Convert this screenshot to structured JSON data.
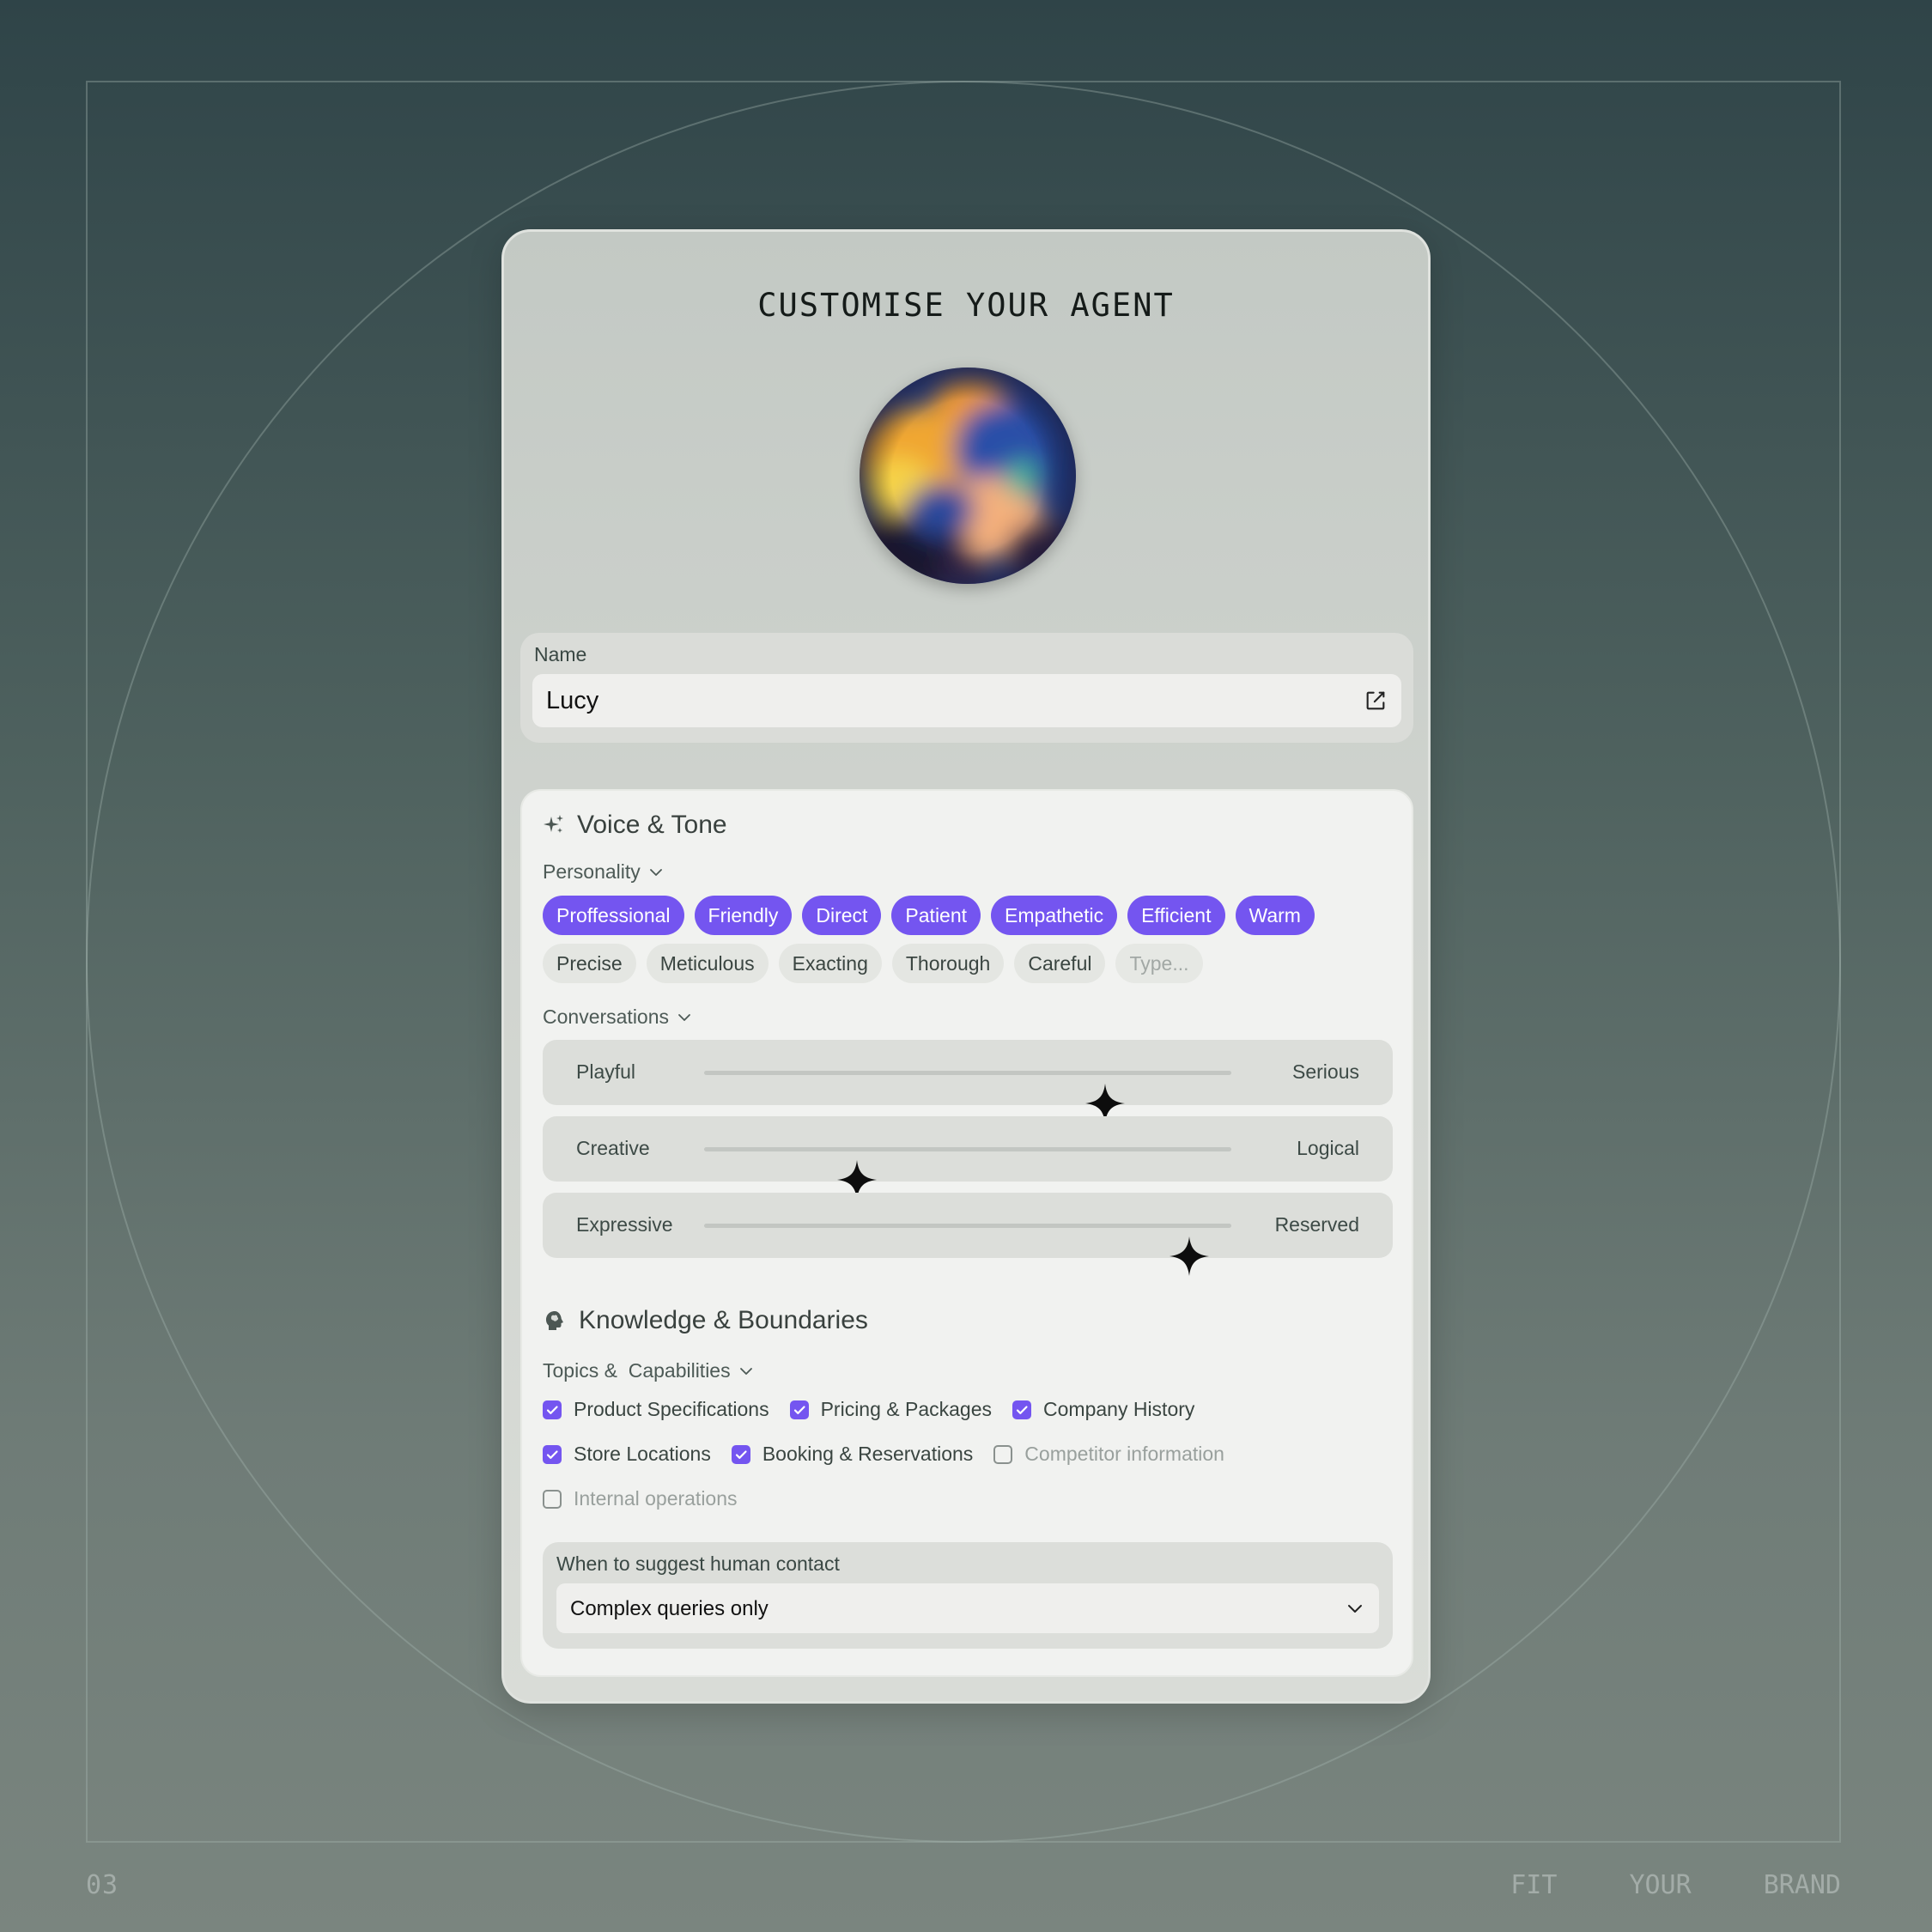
{
  "title": "CUSTOMISE YOUR AGENT",
  "footer": {
    "page_number": "03",
    "words": [
      "FIT",
      "YOUR",
      "BRAND"
    ]
  },
  "name_field": {
    "label": "Name",
    "value": "Lucy",
    "icon": "edit-icon"
  },
  "voice_tone": {
    "heading": "Voice & Tone",
    "icon": "sparkles-icon",
    "personality": {
      "label": "Personality",
      "selected": [
        "Proffessional",
        "Friendly",
        "Direct",
        "Patient",
        "Empathetic",
        "Efficient",
        "Warm"
      ],
      "unselected": [
        "Precise",
        "Meticulous",
        "Exacting",
        "Thorough",
        "Careful"
      ],
      "input_placeholder": "Type..."
    },
    "conversations": {
      "label": "Conversations",
      "sliders": [
        {
          "left": "Playful",
          "right": "Serious",
          "value": 0.76
        },
        {
          "left": "Creative",
          "right": "Logical",
          "value": 0.29
        },
        {
          "left": "Expressive",
          "right": "Reserved",
          "value": 0.92
        }
      ]
    }
  },
  "knowledge": {
    "heading": "Knowledge & Boundaries",
    "icon": "brain-head-icon",
    "topics_label": "Topics &  Capabilities",
    "topics": [
      [
        {
          "label": "Product Specifications",
          "checked": true
        },
        {
          "label": "Pricing & Packages",
          "checked": true
        },
        {
          "label": "Company History",
          "checked": true
        }
      ],
      [
        {
          "label": "Store Locations",
          "checked": true
        },
        {
          "label": "Booking & Reservations",
          "checked": true
        },
        {
          "label": "Competitor information",
          "checked": false
        }
      ],
      [
        {
          "label": "Internal operations",
          "checked": false
        }
      ]
    ],
    "human_contact": {
      "label": "When to suggest human contact",
      "value": "Complex queries only"
    }
  },
  "colors": {
    "accent": "#7455f0",
    "card": "#cfd3ce",
    "panel": "#f1f2f0"
  }
}
